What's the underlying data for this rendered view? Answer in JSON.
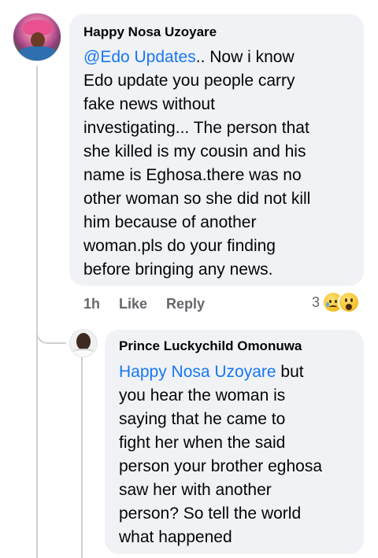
{
  "comment": {
    "author": "Happy Nosa Uzoyare",
    "mention": "@Edo Updates",
    "body_lines": [
      "",
      "Edo update you people carry",
      "fake news without",
      "investigating... The person that",
      "she killed is my cousin and his",
      "name is Eghosa.there was no",
      "other woman so she did not kill",
      "him because of another",
      "woman.pls do your finding",
      "before bringing any news."
    ],
    "first_line_rest": ".. Now i know",
    "time": "1h",
    "like_label": "Like",
    "reply_label": "Reply",
    "reaction_count": "3",
    "reactions": [
      "sad-reaction-icon",
      "wow-reaction-icon"
    ]
  },
  "reply": {
    "author": "Prince Luckychild Omonuwa",
    "mention": "Happy Nosa Uzoyare",
    "first_line_rest": " but",
    "body_lines": [
      "you hear the woman is",
      "saying that he came to",
      "fight her when the said",
      "person your brother eghosa",
      "saw her with another",
      "person? So tell the world",
      "what happened"
    ]
  },
  "colors": {
    "bubble": "#f0f2f5",
    "mention": "#1877f2",
    "meta": "#65676b",
    "thread_line": "#ced0d4"
  }
}
